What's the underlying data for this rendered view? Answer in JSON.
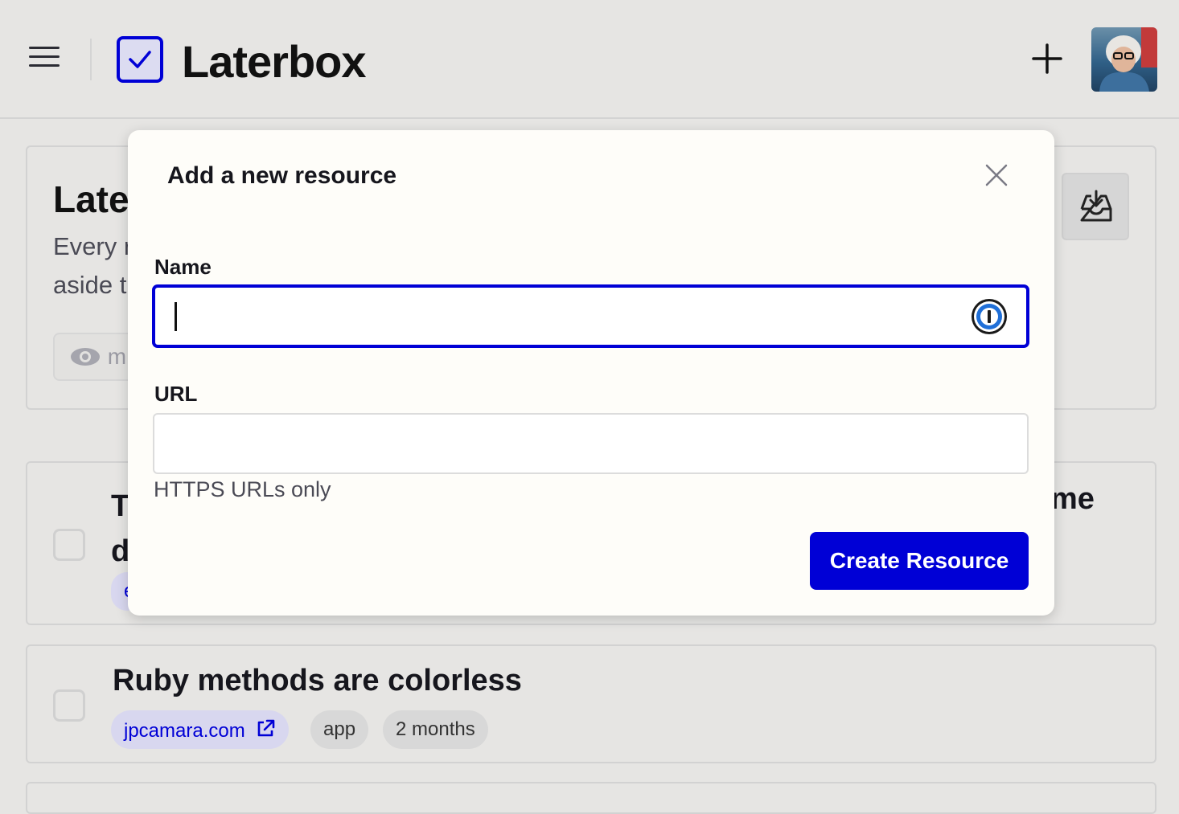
{
  "app": {
    "brand": "Laterbox",
    "accent_color": "#0000d6"
  },
  "header": {
    "menu_icon": "hamburger-icon",
    "logo_icon": "checkbox-check-icon",
    "add_icon": "plus-icon"
  },
  "intro": {
    "title_partial": "Late",
    "desc_partial": "Every r\naside t",
    "pill_partial": "m",
    "inbox_icon": "inbox-download-icon"
  },
  "resources": [
    {
      "title_left_partial": "T\nd",
      "title_right_partial": "me",
      "tag_partial": "e"
    },
    {
      "title": "Ruby methods are colorless",
      "domain": "jpcamara.com",
      "tag": "app",
      "age": "2 months"
    }
  ],
  "modal": {
    "title": "Add a new resource",
    "name_label": "Name",
    "name_value": "",
    "url_label": "URL",
    "url_value": "",
    "url_hint": "HTTPS URLs only",
    "submit_label": "Create Resource"
  }
}
